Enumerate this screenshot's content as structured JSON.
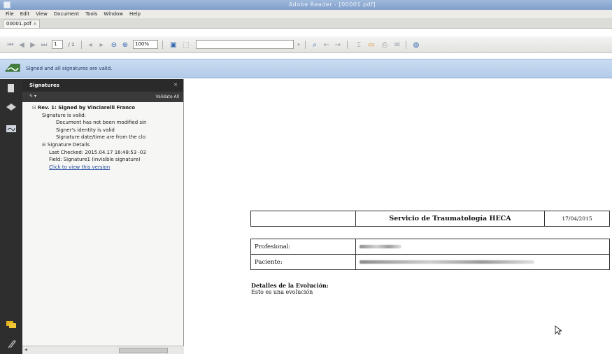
{
  "window": {
    "title": "Adobe Reader - [00001.pdf]"
  },
  "menu": [
    "File",
    "Edit",
    "View",
    "Document",
    "Tools",
    "Window",
    "Help"
  ],
  "tab": {
    "label": "00001.pdf",
    "close": "x"
  },
  "toolbar": {
    "page_value": "1",
    "page_total": "/ 1",
    "zoom": "100%"
  },
  "signature_bar": {
    "message": "Signed and all signatures are valid."
  },
  "panel": {
    "title": "Signatures",
    "close": "×",
    "options_label": "▾",
    "validate_all": "Validate All",
    "tree": {
      "rev": "Rev. 1: Signed by Vinciarelli Franco",
      "valid": "Signature is valid:",
      "not_modified": "Document has not been modified sin",
      "identity": "Signer's identity is valid",
      "datetime": "Signature date/time are from the clo",
      "details": "Signature Details",
      "last_checked": "Last Checked: 2015.04.17 16:48:53 -03",
      "field": "Field: Signature1 (invisible signature)",
      "view_version": "Click to view this version"
    }
  },
  "document": {
    "header_title": "Servicio de Traumatología HECA",
    "header_date": "17/04/2015",
    "profesional_label": "Profesional:",
    "paciente_label": "Paciente:",
    "evolution_heading": "Detalles de la Evolución:",
    "evolution_text": "Esto es una evolución"
  },
  "colors": {
    "sig_bar": "#c9dcf1",
    "panel_dark": "#2a2a2a",
    "link": "#2349a0"
  }
}
